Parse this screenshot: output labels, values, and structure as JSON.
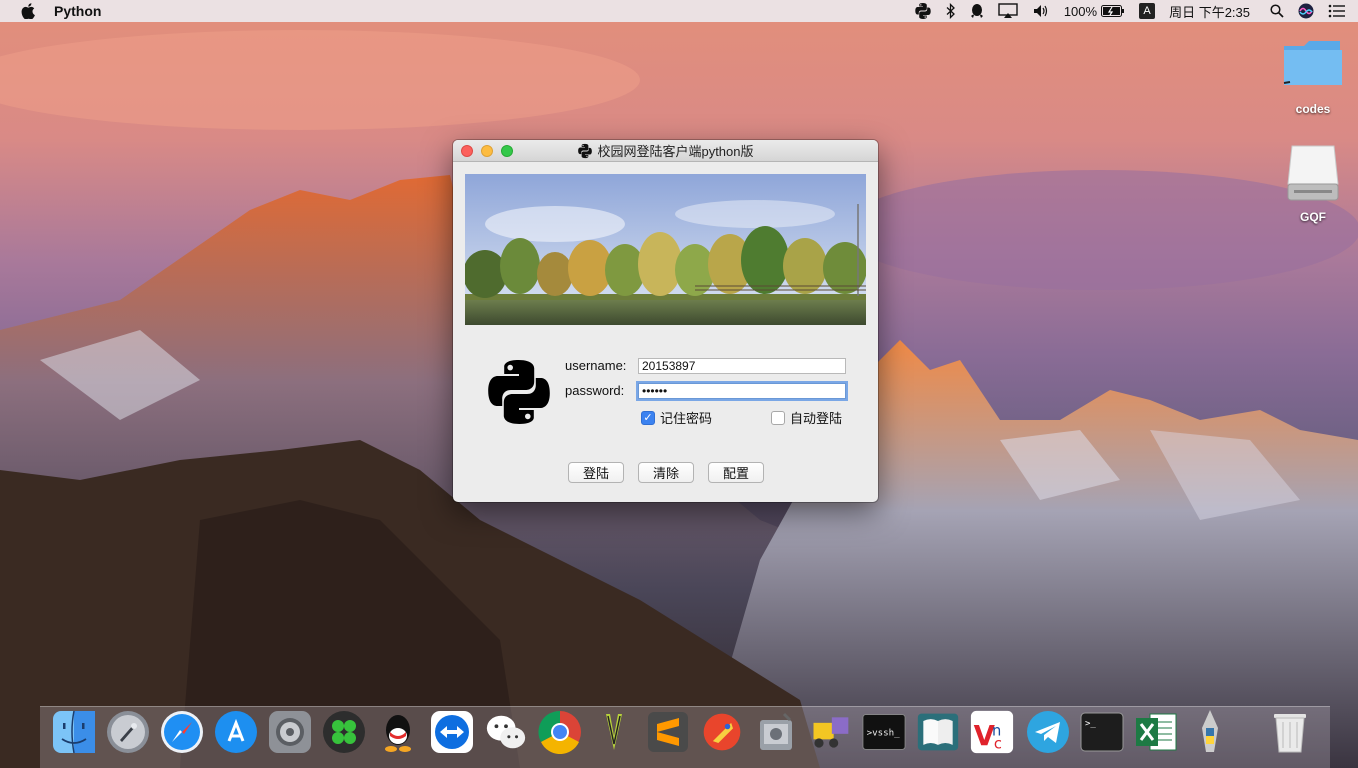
{
  "menubar": {
    "app_name": "Python",
    "battery": "100%",
    "input_method": "A",
    "clock": "周日 下午2:35"
  },
  "desktop": {
    "icons": [
      {
        "label": "codes",
        "icon": "folder-icon"
      },
      {
        "label": "GQF",
        "icon": "drive-icon"
      }
    ]
  },
  "window": {
    "title": "校园网登陆客户端python版",
    "username_label": "username:",
    "username_value": "20153897",
    "password_label": "password:",
    "password_value": "••••••",
    "remember_label": "记住密码",
    "remember_checked": true,
    "autologin_label": "自动登陆",
    "autologin_checked": false,
    "buttons": {
      "login": "登陆",
      "clear": "清除",
      "config": "配置"
    }
  },
  "dock": {
    "apps": [
      "finder-icon",
      "launchpad-icon",
      "safari-icon",
      "app-store-icon",
      "system-preferences-icon",
      "clover-icon",
      "qq-icon",
      "teamviewer-icon",
      "wechat-icon",
      "chrome-icon",
      "vim-icon",
      "sublime-text-icon",
      "rocket-app-icon",
      "disk-utility-icon",
      "transmit-icon",
      "vssh-icon",
      "dictionary-icon",
      "vnc-viewer-icon",
      "telegram-icon",
      "terminal-icon",
      "excel-icon",
      "python-launcher-icon",
      "trash-icon"
    ]
  }
}
